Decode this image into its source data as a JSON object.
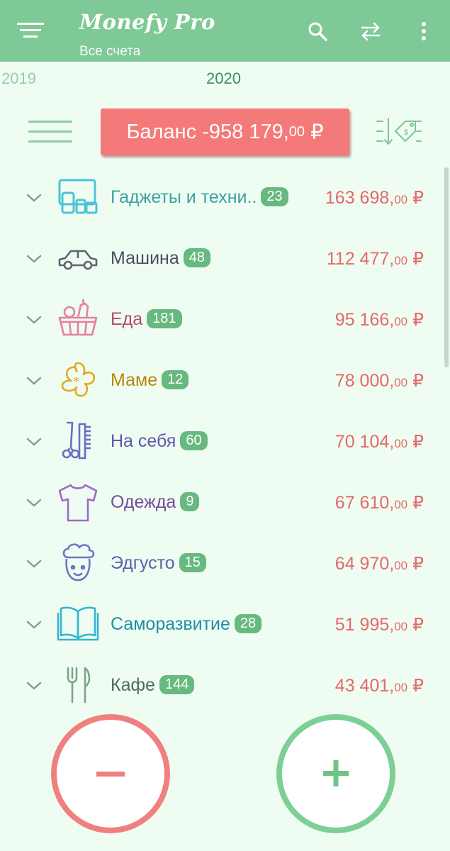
{
  "app_bar": {
    "title": "Monefy Pro",
    "subtitle": "Все счета",
    "color": "#7ec996"
  },
  "years": {
    "previous": "2019",
    "current": "2020"
  },
  "balance": {
    "label": "Баланс",
    "amount_main": "-958 179,",
    "amount_cents": "00",
    "currency": "₽",
    "color": "#f47a7a"
  },
  "categories": [
    {
      "name": "Гаджеты и техни..",
      "count": "23",
      "amount_main": "163 698,",
      "amount_cents": "00",
      "currency": "₽",
      "icon": "gadgets-icon",
      "color": "#3aa3a0"
    },
    {
      "name": "Машина",
      "count": "48",
      "amount_main": "112 477,",
      "amount_cents": "00",
      "currency": "₽",
      "icon": "car-icon",
      "color": "#4a4f5c"
    },
    {
      "name": "Еда",
      "count": "181",
      "amount_main": "95 166,",
      "amount_cents": "00",
      "currency": "₽",
      "icon": "food-basket-icon",
      "color": "#b44d6b"
    },
    {
      "name": "Маме",
      "count": "12",
      "amount_main": "78 000,",
      "amount_cents": "00",
      "currency": "₽",
      "icon": "flower-icon",
      "color": "#b8860b"
    },
    {
      "name": "На себя",
      "count": "60",
      "amount_main": "70 104,",
      "amount_cents": "00",
      "currency": "₽",
      "icon": "scissors-comb-icon",
      "color": "#5c5aa8"
    },
    {
      "name": "Одежда",
      "count": "9",
      "amount_main": "67 610,",
      "amount_cents": "00",
      "currency": "₽",
      "icon": "tshirt-icon",
      "color": "#7a4c9c"
    },
    {
      "name": "Эдгусто",
      "count": "15",
      "amount_main": "64 970,",
      "amount_cents": "00",
      "currency": "₽",
      "icon": "chef-icon",
      "color": "#5a62a8"
    },
    {
      "name": "Саморазвитие",
      "count": "28",
      "amount_main": "51 995,",
      "amount_cents": "00",
      "currency": "₽",
      "icon": "book-icon",
      "color": "#1f8fa5"
    },
    {
      "name": "Кафе",
      "count": "144",
      "amount_main": "43 401,",
      "amount_cents": "00",
      "currency": "₽",
      "icon": "fork-knife-icon",
      "color": "#4e6d5a"
    }
  ],
  "fab": {
    "minus_symbol": "−",
    "plus_symbol": "+",
    "minus_color": "#f08080",
    "plus_color": "#7dcf95"
  }
}
